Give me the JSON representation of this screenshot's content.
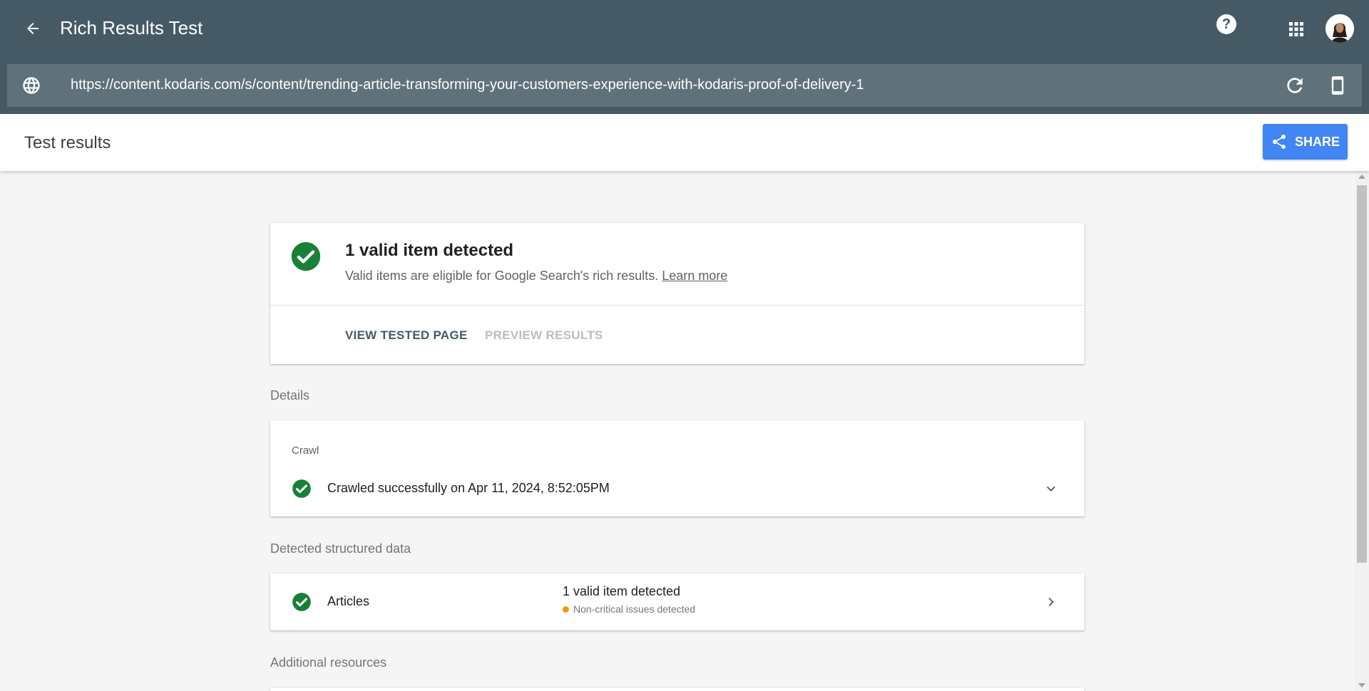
{
  "app": {
    "title": "Rich Results Test",
    "header_bg": "#455a64",
    "urlbar_bg": "#5f727c",
    "accent": "#4285f4",
    "success": "#188038",
    "warning": "#f29900"
  },
  "header": {
    "back_icon": "arrow-back-icon",
    "help_label": "?",
    "apps_icon": "apps-grid-icon",
    "avatar_icon": "user-avatar"
  },
  "urlbar": {
    "url": "https://content.kodaris.com/s/content/trending-article-transforming-your-customers-experience-with-kodaris-proof-of-delivery-1",
    "globe_icon": "globe-icon",
    "refresh_icon": "refresh-icon",
    "device_icon": "smartphone-icon"
  },
  "results_bar": {
    "title": "Test results",
    "share_label": "SHARE"
  },
  "summary": {
    "title": "1 valid item detected",
    "description": "Valid items are eligible for Google Search's rich results.",
    "learn_more": "Learn more",
    "tabs": [
      {
        "label": "VIEW TESTED PAGE",
        "active": true
      },
      {
        "label": "PREVIEW RESULTS",
        "active": false
      }
    ]
  },
  "details": {
    "section_label": "Details",
    "crawl_label": "Crawl",
    "crawl_text": "Crawled successfully on Apr 11, 2024, 8:52:05PM"
  },
  "structured_data": {
    "section_label": "Detected structured data",
    "items": [
      {
        "name": "Articles",
        "status": "1 valid item detected",
        "sub_status": "Non-critical issues detected"
      }
    ]
  },
  "additional": {
    "section_label": "Additional resources"
  }
}
